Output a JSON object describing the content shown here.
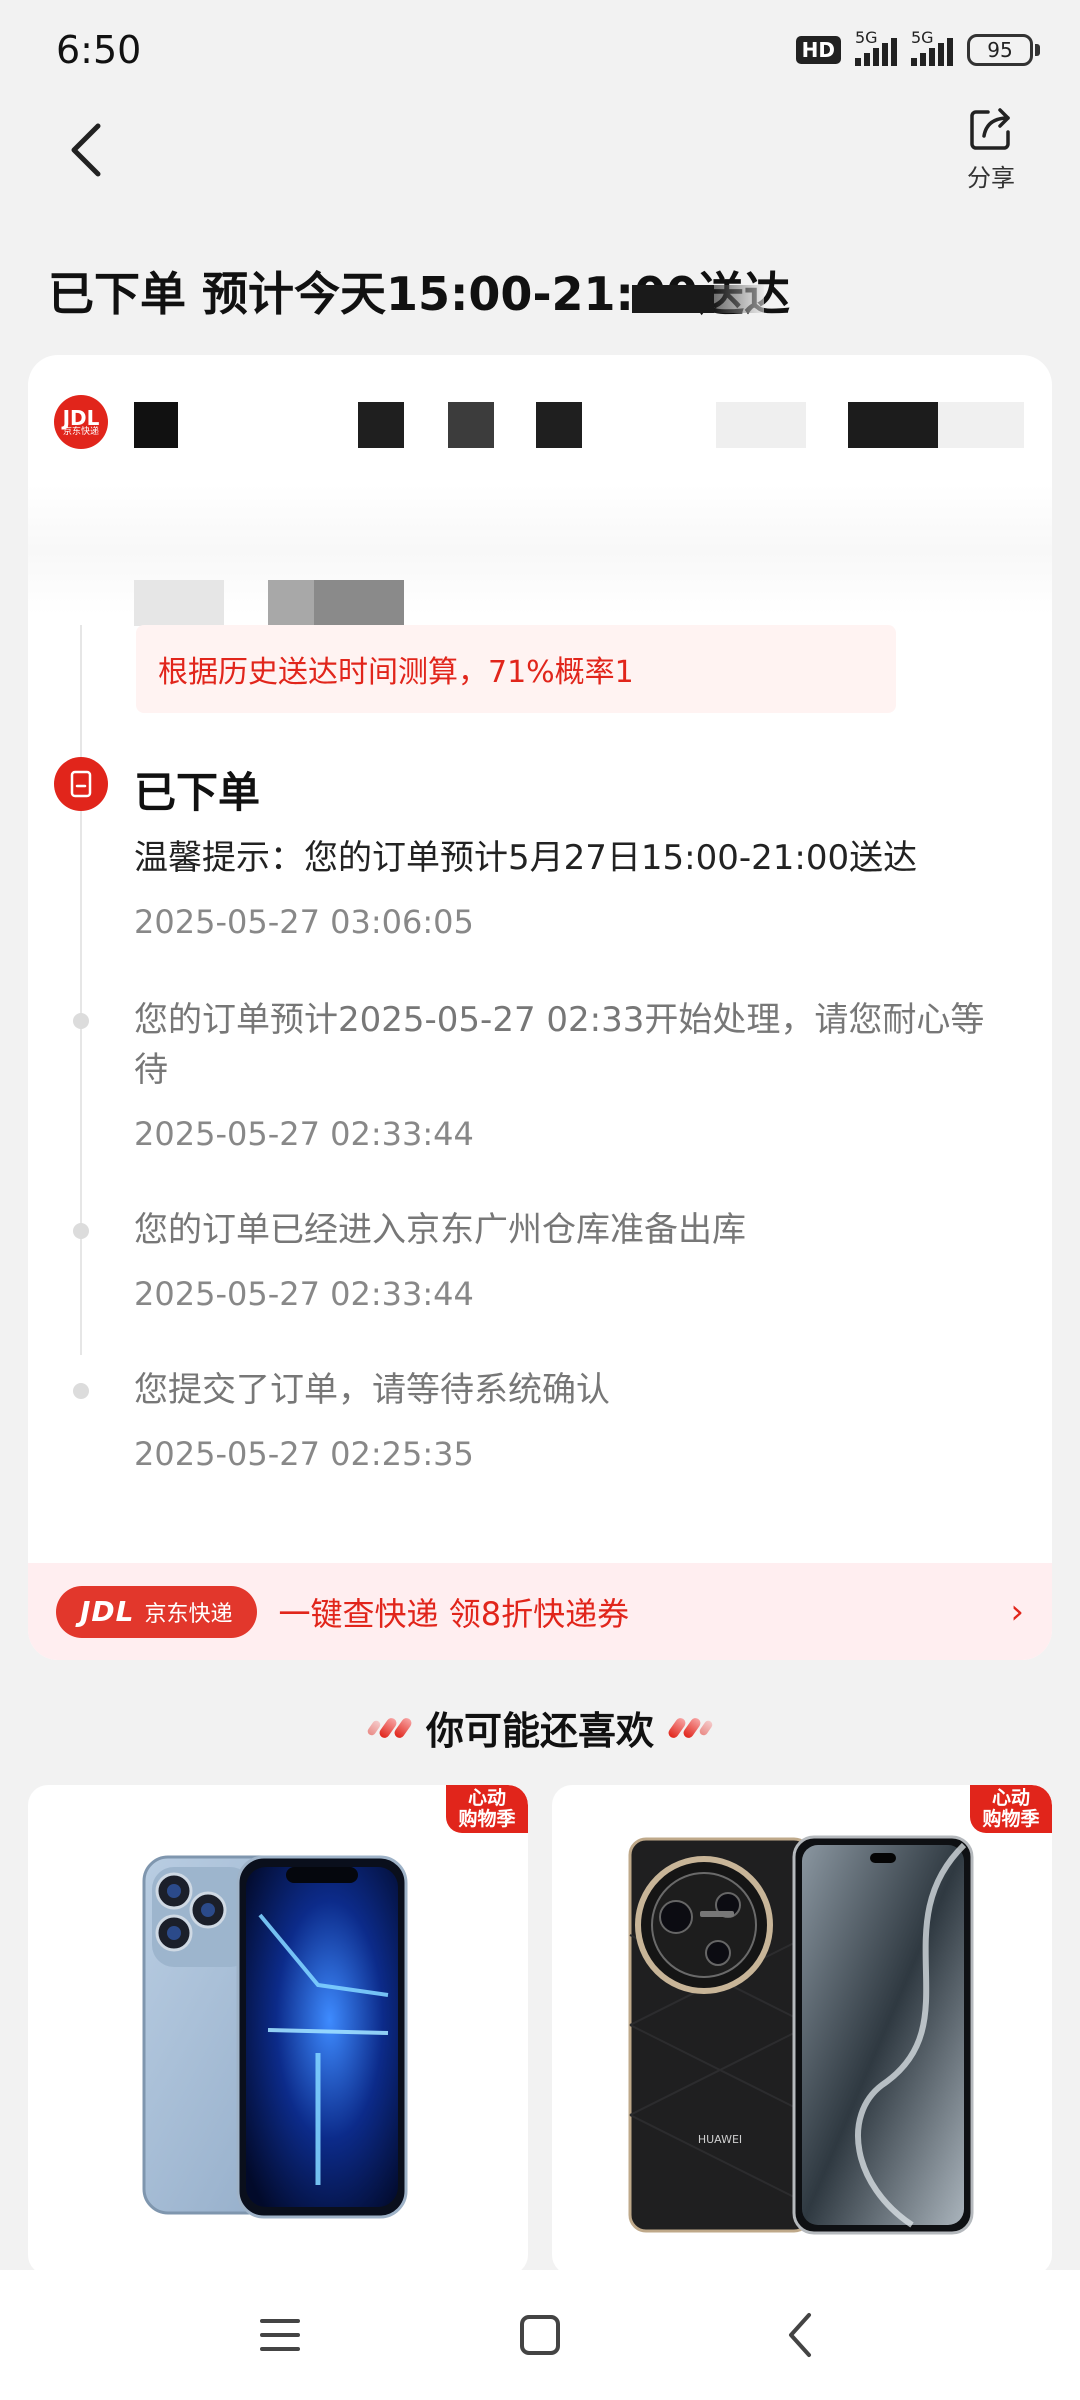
{
  "status_bar": {
    "time": "6:50",
    "hd_label": "HD",
    "signal1_label": "5G",
    "signal2_label": "5G",
    "battery": "95"
  },
  "nav": {
    "share_label": "分享"
  },
  "order": {
    "title": "已下单 预计今天15:00-21:00送达"
  },
  "courier": {
    "logo_text": "JDL",
    "logo_sub": "京东快递"
  },
  "prediction": {
    "text": "根据历史送达时间测算，71%概率1"
  },
  "timeline": {
    "current_status": "已下单",
    "events": [
      {
        "text": "温馨提示：您的订单预计5月27日15:00-21:00送达",
        "date": "2025-05-27 03:06:05"
      },
      {
        "text": "您的订单预计2025-05-27 02:33开始处理，请您耐心等待",
        "date": "2025-05-27 02:33:44"
      },
      {
        "text": "您的订单已经进入京东广州仓库准备出库",
        "date": "2025-05-27 02:33:44"
      },
      {
        "text": "您提交了订单，请等待系统确认",
        "date": "2025-05-27 02:25:35"
      }
    ]
  },
  "promo": {
    "badge_logo": "JDL",
    "badge_text": "京东快递",
    "text": "一键查快递  领8折快递券",
    "chevron": "›"
  },
  "recommendations": {
    "title": "你可能还喜欢",
    "tag_line1": "心动",
    "tag_line2": "购物季",
    "products": [
      {
        "name": "iphone-pro-sierra-blue"
      },
      {
        "name": "huawei-phone-black",
        "brand_mark": "HUAWEI"
      }
    ]
  },
  "colors": {
    "accent": "#e1251b",
    "background": "#f2f2f2",
    "card": "#ffffff",
    "promo_bg": "#ffeef0"
  }
}
